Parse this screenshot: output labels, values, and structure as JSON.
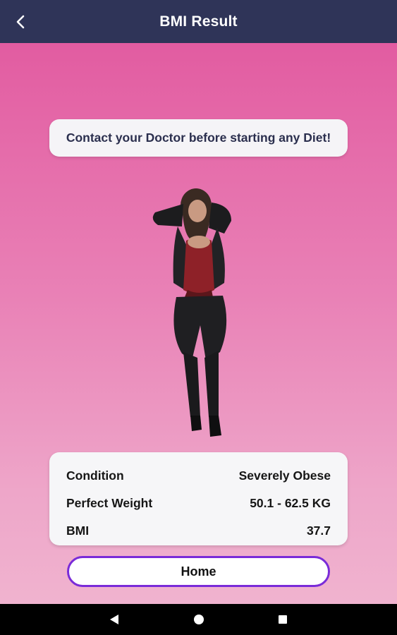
{
  "header": {
    "title": "BMI Result",
    "back_icon": "chevron-left-icon"
  },
  "warning": {
    "text": "Contact your Doctor before starting any Diet!"
  },
  "result": {
    "rows": [
      {
        "label": "Condition",
        "value": "Severely Obese"
      },
      {
        "label": "Perfect Weight",
        "value": "50.1 - 62.5 KG"
      },
      {
        "label": "BMI",
        "value": "37.7"
      }
    ]
  },
  "home_button": {
    "label": "Home"
  },
  "colors": {
    "header_bg": "#2f3458",
    "gradient_top": "#e25ca1",
    "gradient_bottom": "#f0b3cf",
    "button_border": "#7a2bd8"
  },
  "navigation": {
    "icons": [
      "back-triangle-icon",
      "home-circle-icon",
      "recents-square-icon"
    ]
  }
}
